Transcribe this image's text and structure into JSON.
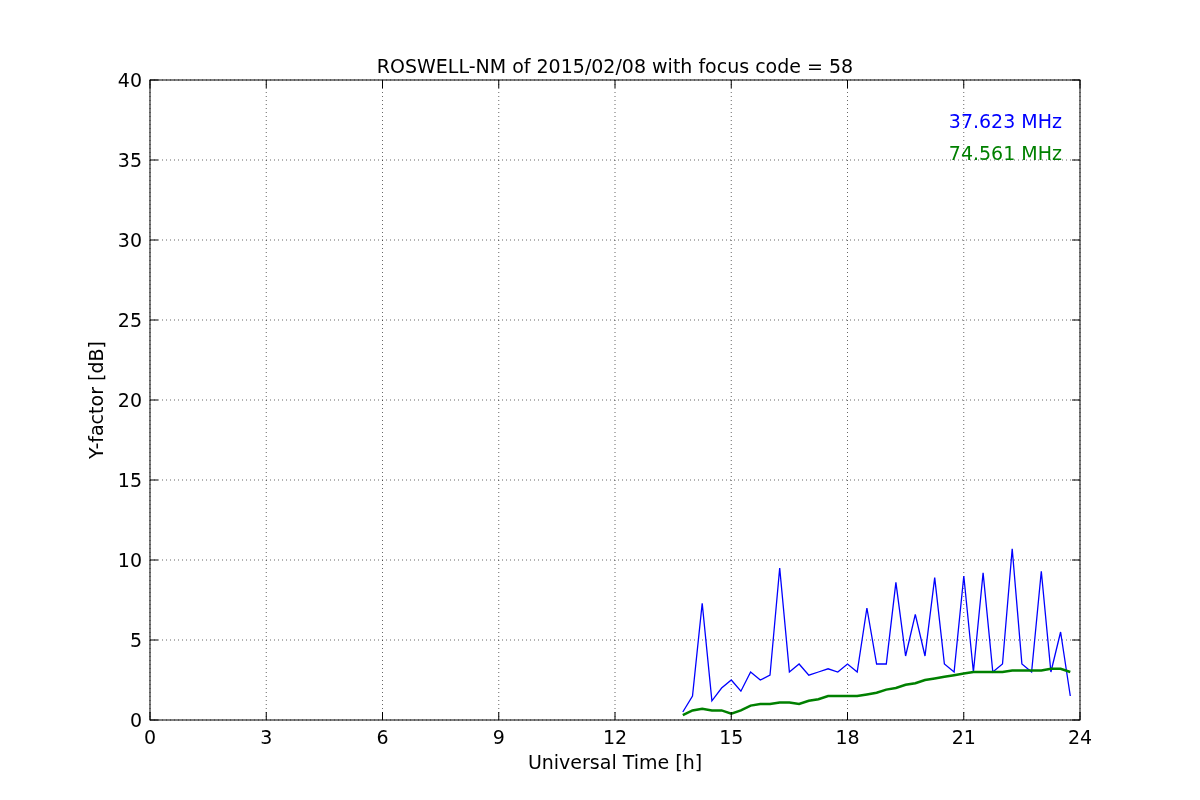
{
  "chart": {
    "chart_data": {
      "type": "line",
      "title": "ROSWELL-NM of 2015/02/08 with focus code = 58",
      "xlabel": "Universal Time [h]",
      "ylabel": "Y-factor [dB]",
      "xlim": [
        0,
        24
      ],
      "ylim": [
        0,
        40
      ],
      "xticks": [
        0,
        3,
        6,
        9,
        12,
        15,
        18,
        21,
        24
      ],
      "yticks": [
        0,
        5,
        10,
        15,
        20,
        25,
        30,
        35,
        40
      ],
      "grid": true,
      "x": [
        13.75,
        14.0,
        14.25,
        14.5,
        14.75,
        15.0,
        15.25,
        15.5,
        15.75,
        16.0,
        16.25,
        16.5,
        16.75,
        17.0,
        17.25,
        17.5,
        17.75,
        18.0,
        18.25,
        18.5,
        18.75,
        19.0,
        19.25,
        19.5,
        19.75,
        20.0,
        20.25,
        20.5,
        20.75,
        21.0,
        21.25,
        21.5,
        21.75,
        22.0,
        22.25,
        22.5,
        22.75,
        23.0,
        23.25,
        23.5,
        23.75
      ],
      "series": [
        {
          "name": "37.623 MHz",
          "color": "#0000ff",
          "values": [
            0.5,
            1.5,
            7.3,
            1.2,
            2.0,
            2.5,
            1.8,
            3.0,
            2.5,
            2.8,
            9.5,
            3.0,
            3.5,
            2.8,
            3.0,
            3.2,
            3.0,
            3.5,
            3.0,
            7.0,
            3.5,
            3.5,
            8.6,
            4.0,
            6.6,
            4.0,
            8.9,
            3.5,
            3.0,
            9.0,
            3.0,
            9.2,
            3.0,
            3.5,
            10.7,
            3.5,
            3.0,
            9.3,
            3.0,
            5.5,
            1.5
          ]
        },
        {
          "name": "74.561 MHz",
          "color": "#008000",
          "values": [
            0.3,
            0.6,
            0.7,
            0.6,
            0.6,
            0.4,
            0.6,
            0.9,
            1.0,
            1.0,
            1.1,
            1.1,
            1.0,
            1.2,
            1.3,
            1.5,
            1.5,
            1.5,
            1.5,
            1.6,
            1.7,
            1.9,
            2.0,
            2.2,
            2.3,
            2.5,
            2.6,
            2.7,
            2.8,
            2.9,
            3.0,
            3.0,
            3.0,
            3.0,
            3.1,
            3.1,
            3.1,
            3.1,
            3.2,
            3.2,
            3.0
          ]
        }
      ]
    }
  }
}
